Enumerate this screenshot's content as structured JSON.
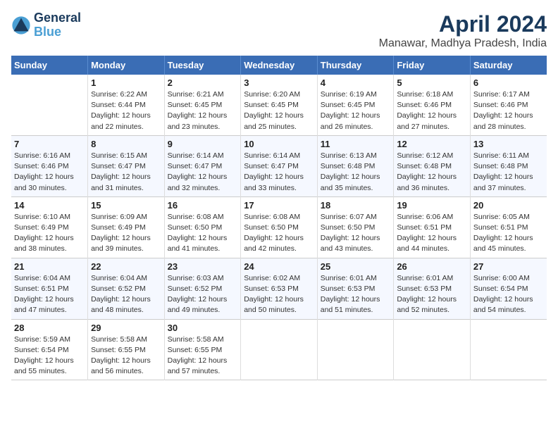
{
  "logo": {
    "line1": "General",
    "line2": "Blue"
  },
  "title": "April 2024",
  "subtitle": "Manawar, Madhya Pradesh, India",
  "header": {
    "days": [
      "Sunday",
      "Monday",
      "Tuesday",
      "Wednesday",
      "Thursday",
      "Friday",
      "Saturday"
    ]
  },
  "weeks": [
    [
      {
        "num": "",
        "info": ""
      },
      {
        "num": "1",
        "info": "Sunrise: 6:22 AM\nSunset: 6:44 PM\nDaylight: 12 hours\nand 22 minutes."
      },
      {
        "num": "2",
        "info": "Sunrise: 6:21 AM\nSunset: 6:45 PM\nDaylight: 12 hours\nand 23 minutes."
      },
      {
        "num": "3",
        "info": "Sunrise: 6:20 AM\nSunset: 6:45 PM\nDaylight: 12 hours\nand 25 minutes."
      },
      {
        "num": "4",
        "info": "Sunrise: 6:19 AM\nSunset: 6:45 PM\nDaylight: 12 hours\nand 26 minutes."
      },
      {
        "num": "5",
        "info": "Sunrise: 6:18 AM\nSunset: 6:46 PM\nDaylight: 12 hours\nand 27 minutes."
      },
      {
        "num": "6",
        "info": "Sunrise: 6:17 AM\nSunset: 6:46 PM\nDaylight: 12 hours\nand 28 minutes."
      }
    ],
    [
      {
        "num": "7",
        "info": "Sunrise: 6:16 AM\nSunset: 6:46 PM\nDaylight: 12 hours\nand 30 minutes."
      },
      {
        "num": "8",
        "info": "Sunrise: 6:15 AM\nSunset: 6:47 PM\nDaylight: 12 hours\nand 31 minutes."
      },
      {
        "num": "9",
        "info": "Sunrise: 6:14 AM\nSunset: 6:47 PM\nDaylight: 12 hours\nand 32 minutes."
      },
      {
        "num": "10",
        "info": "Sunrise: 6:14 AM\nSunset: 6:47 PM\nDaylight: 12 hours\nand 33 minutes."
      },
      {
        "num": "11",
        "info": "Sunrise: 6:13 AM\nSunset: 6:48 PM\nDaylight: 12 hours\nand 35 minutes."
      },
      {
        "num": "12",
        "info": "Sunrise: 6:12 AM\nSunset: 6:48 PM\nDaylight: 12 hours\nand 36 minutes."
      },
      {
        "num": "13",
        "info": "Sunrise: 6:11 AM\nSunset: 6:48 PM\nDaylight: 12 hours\nand 37 minutes."
      }
    ],
    [
      {
        "num": "14",
        "info": "Sunrise: 6:10 AM\nSunset: 6:49 PM\nDaylight: 12 hours\nand 38 minutes."
      },
      {
        "num": "15",
        "info": "Sunrise: 6:09 AM\nSunset: 6:49 PM\nDaylight: 12 hours\nand 39 minutes."
      },
      {
        "num": "16",
        "info": "Sunrise: 6:08 AM\nSunset: 6:50 PM\nDaylight: 12 hours\nand 41 minutes."
      },
      {
        "num": "17",
        "info": "Sunrise: 6:08 AM\nSunset: 6:50 PM\nDaylight: 12 hours\nand 42 minutes."
      },
      {
        "num": "18",
        "info": "Sunrise: 6:07 AM\nSunset: 6:50 PM\nDaylight: 12 hours\nand 43 minutes."
      },
      {
        "num": "19",
        "info": "Sunrise: 6:06 AM\nSunset: 6:51 PM\nDaylight: 12 hours\nand 44 minutes."
      },
      {
        "num": "20",
        "info": "Sunrise: 6:05 AM\nSunset: 6:51 PM\nDaylight: 12 hours\nand 45 minutes."
      }
    ],
    [
      {
        "num": "21",
        "info": "Sunrise: 6:04 AM\nSunset: 6:51 PM\nDaylight: 12 hours\nand 47 minutes."
      },
      {
        "num": "22",
        "info": "Sunrise: 6:04 AM\nSunset: 6:52 PM\nDaylight: 12 hours\nand 48 minutes."
      },
      {
        "num": "23",
        "info": "Sunrise: 6:03 AM\nSunset: 6:52 PM\nDaylight: 12 hours\nand 49 minutes."
      },
      {
        "num": "24",
        "info": "Sunrise: 6:02 AM\nSunset: 6:53 PM\nDaylight: 12 hours\nand 50 minutes."
      },
      {
        "num": "25",
        "info": "Sunrise: 6:01 AM\nSunset: 6:53 PM\nDaylight: 12 hours\nand 51 minutes."
      },
      {
        "num": "26",
        "info": "Sunrise: 6:01 AM\nSunset: 6:53 PM\nDaylight: 12 hours\nand 52 minutes."
      },
      {
        "num": "27",
        "info": "Sunrise: 6:00 AM\nSunset: 6:54 PM\nDaylight: 12 hours\nand 54 minutes."
      }
    ],
    [
      {
        "num": "28",
        "info": "Sunrise: 5:59 AM\nSunset: 6:54 PM\nDaylight: 12 hours\nand 55 minutes."
      },
      {
        "num": "29",
        "info": "Sunrise: 5:58 AM\nSunset: 6:55 PM\nDaylight: 12 hours\nand 56 minutes."
      },
      {
        "num": "30",
        "info": "Sunrise: 5:58 AM\nSunset: 6:55 PM\nDaylight: 12 hours\nand 57 minutes."
      },
      {
        "num": "",
        "info": ""
      },
      {
        "num": "",
        "info": ""
      },
      {
        "num": "",
        "info": ""
      },
      {
        "num": "",
        "info": ""
      }
    ]
  ]
}
